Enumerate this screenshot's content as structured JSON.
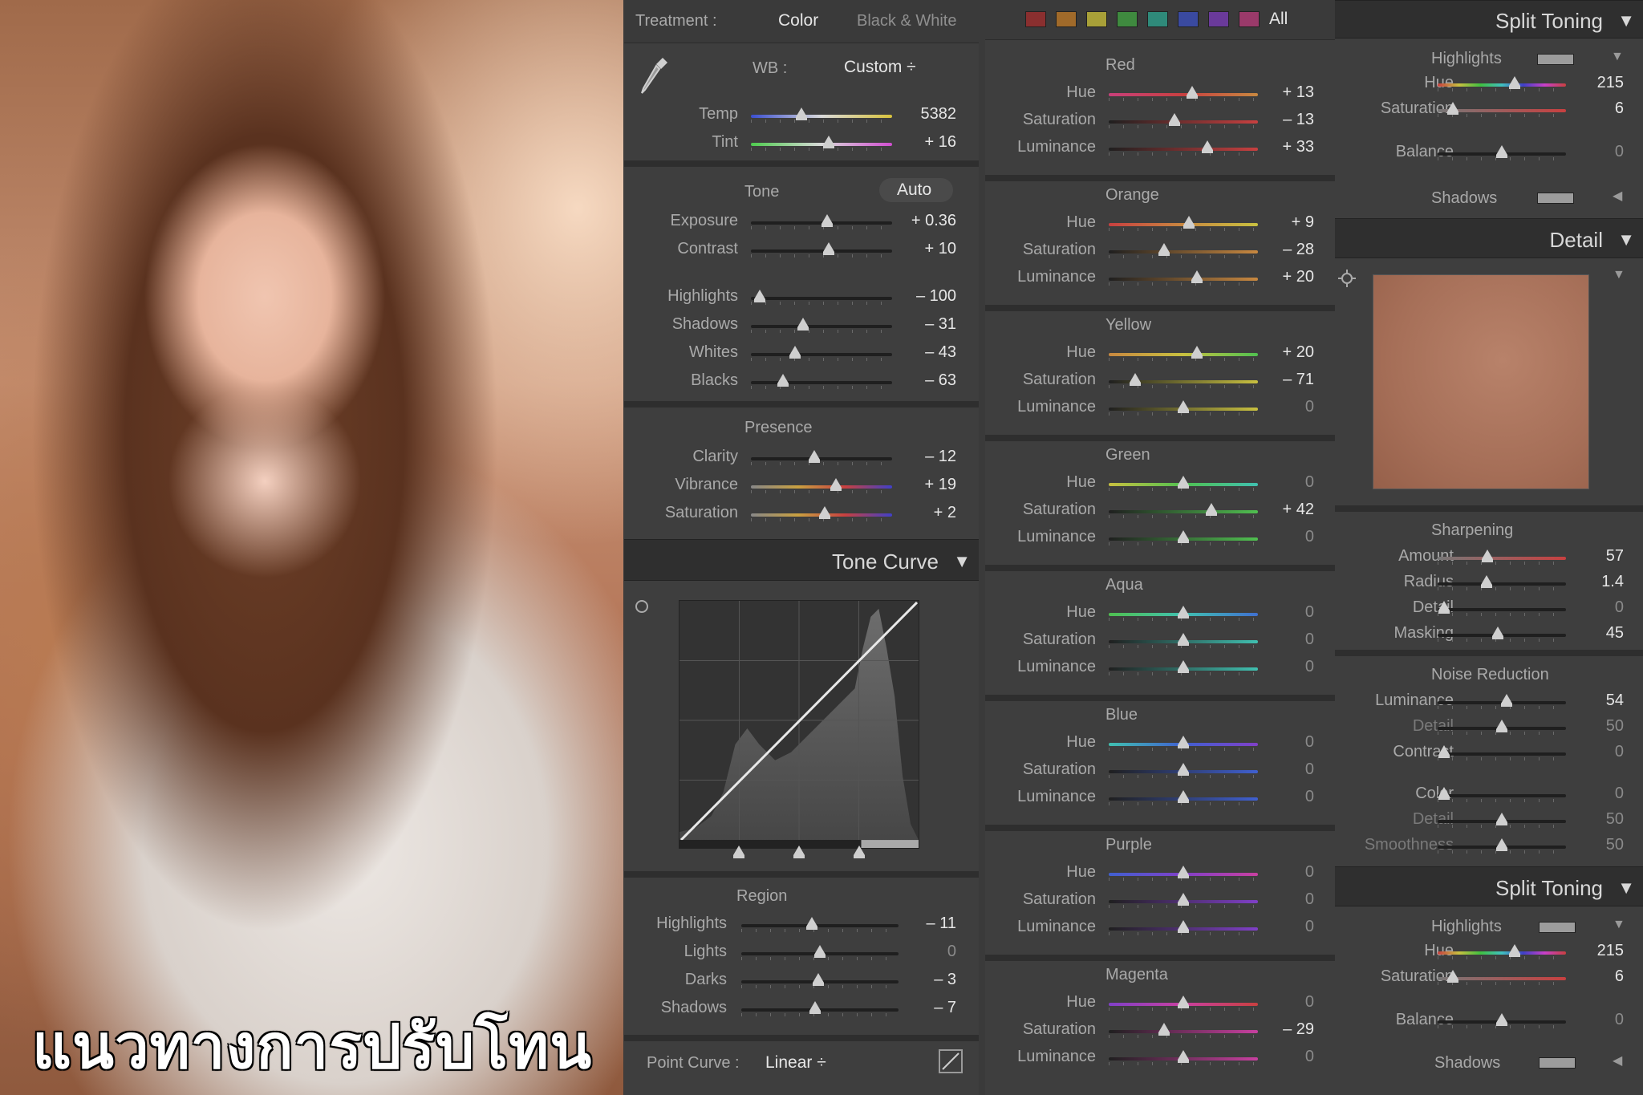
{
  "photo": {
    "caption": "แนวทางการปรับโทน"
  },
  "treatment": {
    "label": "Treatment :",
    "color": "Color",
    "bw": "Black & White"
  },
  "wb": {
    "label": "WB :",
    "value": "Custom ÷"
  },
  "basic": {
    "temp": {
      "label": "Temp",
      "value": "5382",
      "level": 0.36
    },
    "tint": {
      "label": "Tint",
      "value": "+ 16",
      "level": 0.55
    }
  },
  "tone": {
    "label": "Tone",
    "auto": "Auto",
    "exposure": {
      "label": "Exposure",
      "value": "+ 0.36",
      "level": 0.54
    },
    "contrast": {
      "label": "Contrast",
      "value": "+ 10",
      "level": 0.55
    },
    "highlights": {
      "label": "Highlights",
      "value": "– 100",
      "level": 0.06
    },
    "shadows": {
      "label": "Shadows",
      "value": "– 31",
      "level": 0.37
    },
    "whites": {
      "label": "Whites",
      "value": "– 43",
      "level": 0.31
    },
    "blacks": {
      "label": "Blacks",
      "value": "– 63",
      "level": 0.23
    }
  },
  "presence": {
    "label": "Presence",
    "clarity": {
      "label": "Clarity",
      "value": "– 12",
      "level": 0.45
    },
    "vibrance": {
      "label": "Vibrance",
      "value": "+ 19",
      "level": 0.6
    },
    "saturation": {
      "label": "Saturation",
      "value": "+ 2",
      "level": 0.52
    }
  },
  "tone_curve": {
    "title": "Tone Curve",
    "region": "Region",
    "highlights": {
      "label": "Highlights",
      "value": "– 11",
      "level": 0.45
    },
    "lights": {
      "label": "Lights",
      "value": "0",
      "level": 0.5
    },
    "darks": {
      "label": "Darks",
      "value": "– 3",
      "level": 0.49
    },
    "shadows": {
      "label": "Shadows",
      "value": "– 7",
      "level": 0.47
    },
    "point_curve_label": "Point Curve :",
    "point_curve_value": "Linear ÷"
  },
  "hsl": {
    "all": "All",
    "swatches": [
      "#8a2f2f",
      "#a06a2a",
      "#a8a038",
      "#3f8a3f",
      "#2f8a7a",
      "#3a4aa0",
      "#6a3a9a",
      "#9a3a6a"
    ],
    "colors": [
      {
        "name": "Red",
        "hue": "+ 13",
        "hl": 0.56,
        "sat": "– 13",
        "sl": 0.44,
        "lum": "+ 33",
        "ll": 0.66
      },
      {
        "name": "Orange",
        "hue": "+ 9",
        "hl": 0.54,
        "sat": "– 28",
        "sl": 0.37,
        "lum": "+ 20",
        "ll": 0.59
      },
      {
        "name": "Yellow",
        "hue": "+ 20",
        "hl": 0.59,
        "sat": "– 71",
        "sl": 0.18,
        "lum": "0",
        "ll": 0.5
      },
      {
        "name": "Green",
        "hue": "0",
        "hl": 0.5,
        "sat": "+ 42",
        "sl": 0.69,
        "lum": "0",
        "ll": 0.5
      },
      {
        "name": "Aqua",
        "hue": "0",
        "hl": 0.5,
        "sat": "0",
        "sl": 0.5,
        "lum": "0",
        "ll": 0.5
      },
      {
        "name": "Blue",
        "hue": "0",
        "hl": 0.5,
        "sat": "0",
        "sl": 0.5,
        "lum": "0",
        "ll": 0.5
      },
      {
        "name": "Purple",
        "hue": "0",
        "hl": 0.5,
        "sat": "0",
        "sl": 0.5,
        "lum": "0",
        "ll": 0.5
      },
      {
        "name": "Magenta",
        "hue": "0",
        "hl": 0.5,
        "sat": "– 29",
        "sl": 0.37,
        "lum": "0",
        "ll": 0.5
      }
    ],
    "labels": {
      "hue": "Hue",
      "sat": "Saturation",
      "lum": "Luminance"
    }
  },
  "split1": {
    "title": "Split Toning",
    "highlights": "Highlights",
    "hue": {
      "label": "Hue",
      "value": "215",
      "level": 0.6
    },
    "saturation": {
      "label": "Saturation",
      "value": "6",
      "level": 0.12
    },
    "balance": {
      "label": "Balance",
      "value": "0",
      "level": 0.5
    },
    "shadows": "Shadows"
  },
  "detail": {
    "title": "Detail",
    "sharpening": "Sharpening",
    "amount": {
      "label": "Amount",
      "value": "57",
      "level": 0.39
    },
    "radius": {
      "label": "Radius",
      "value": "1.4",
      "level": 0.38
    },
    "detail": {
      "label": "Detail",
      "value": "0",
      "level": 0.05
    },
    "masking": {
      "label": "Masking",
      "value": "45",
      "level": 0.47
    },
    "noise": "Noise Reduction",
    "luminance": {
      "label": "Luminance",
      "value": "54",
      "level": 0.54
    },
    "ndetail": {
      "label": "Detail",
      "value": "50",
      "level": 0.5
    },
    "contrast": {
      "label": "Contrast",
      "value": "0",
      "level": 0.05
    },
    "color": {
      "label": "Color",
      "value": "0",
      "level": 0.05
    },
    "cdetail": {
      "label": "Detail",
      "value": "50",
      "level": 0.5
    },
    "smoothness": {
      "label": "Smoothness",
      "value": "50",
      "level": 0.5
    }
  },
  "split2": {
    "title": "Split Toning",
    "highlights": "Highlights",
    "hue": {
      "label": "Hue",
      "value": "215",
      "level": 0.6
    },
    "saturation": {
      "label": "Saturation",
      "value": "6",
      "level": 0.12
    },
    "balance": {
      "label": "Balance",
      "value": "0",
      "level": 0.5
    },
    "shadows": "Shadows"
  }
}
